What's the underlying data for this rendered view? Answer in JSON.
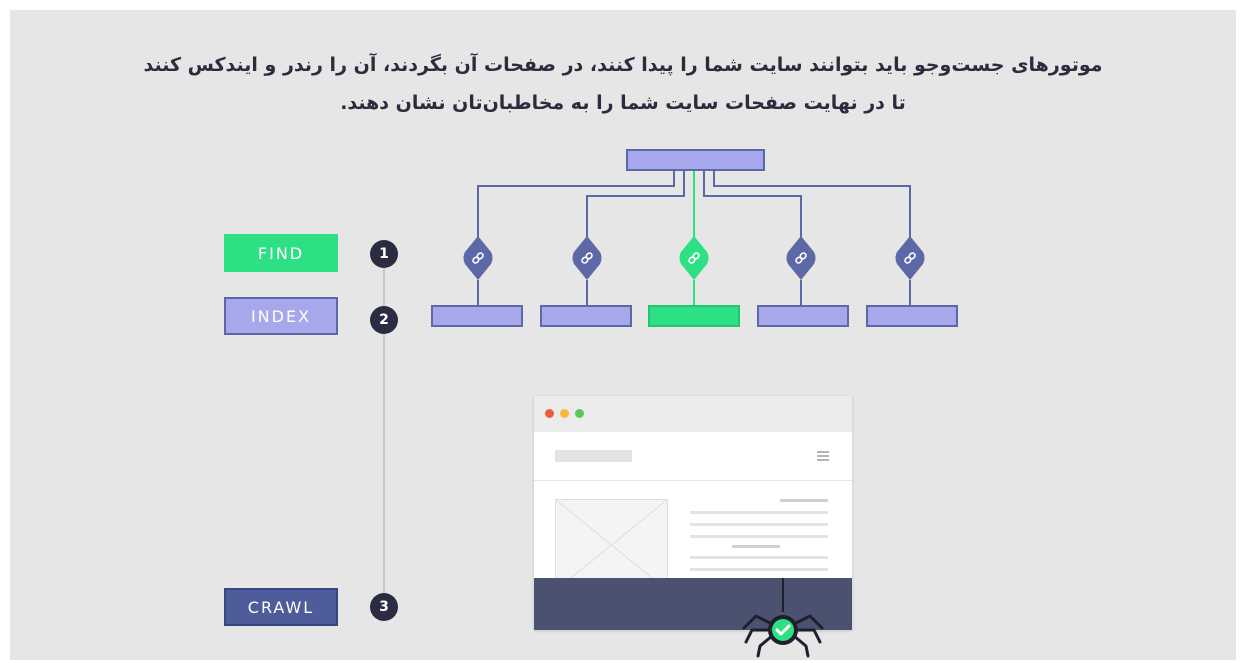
{
  "heading": {
    "line1": "موتورهای جست‌وجو باید بتوانند سایت شما را پیدا کنند، در صفحات آن بگردند، آن را رندر و ایندکس کنند",
    "line2": "تا در نهایت صفحات سایت شما را به مخاطبان‌تان نشان دهند."
  },
  "steps": [
    {
      "number": "1",
      "label": "FIND",
      "color": "#2ee084"
    },
    {
      "number": "2",
      "label": "INDEX",
      "color": "#a7a7ec"
    },
    {
      "number": "3",
      "label": "CRAWL",
      "color": "#4e5d9a"
    }
  ],
  "colors": {
    "background": "#e6e6e6",
    "node_purple": "#a7a7ec",
    "node_border": "#5d68a6",
    "link_diamond": "#5d68a6",
    "highlight_green": "#2ee084",
    "dark_text": "#2b2d3e",
    "footer_dark": "#4b5270"
  },
  "icons": {
    "link": "link-icon",
    "check": "check-icon",
    "spider": "spider-icon",
    "menu": "hamburger-menu-icon"
  },
  "tree": {
    "highlighted_branch": 3,
    "branch_count": 5
  }
}
